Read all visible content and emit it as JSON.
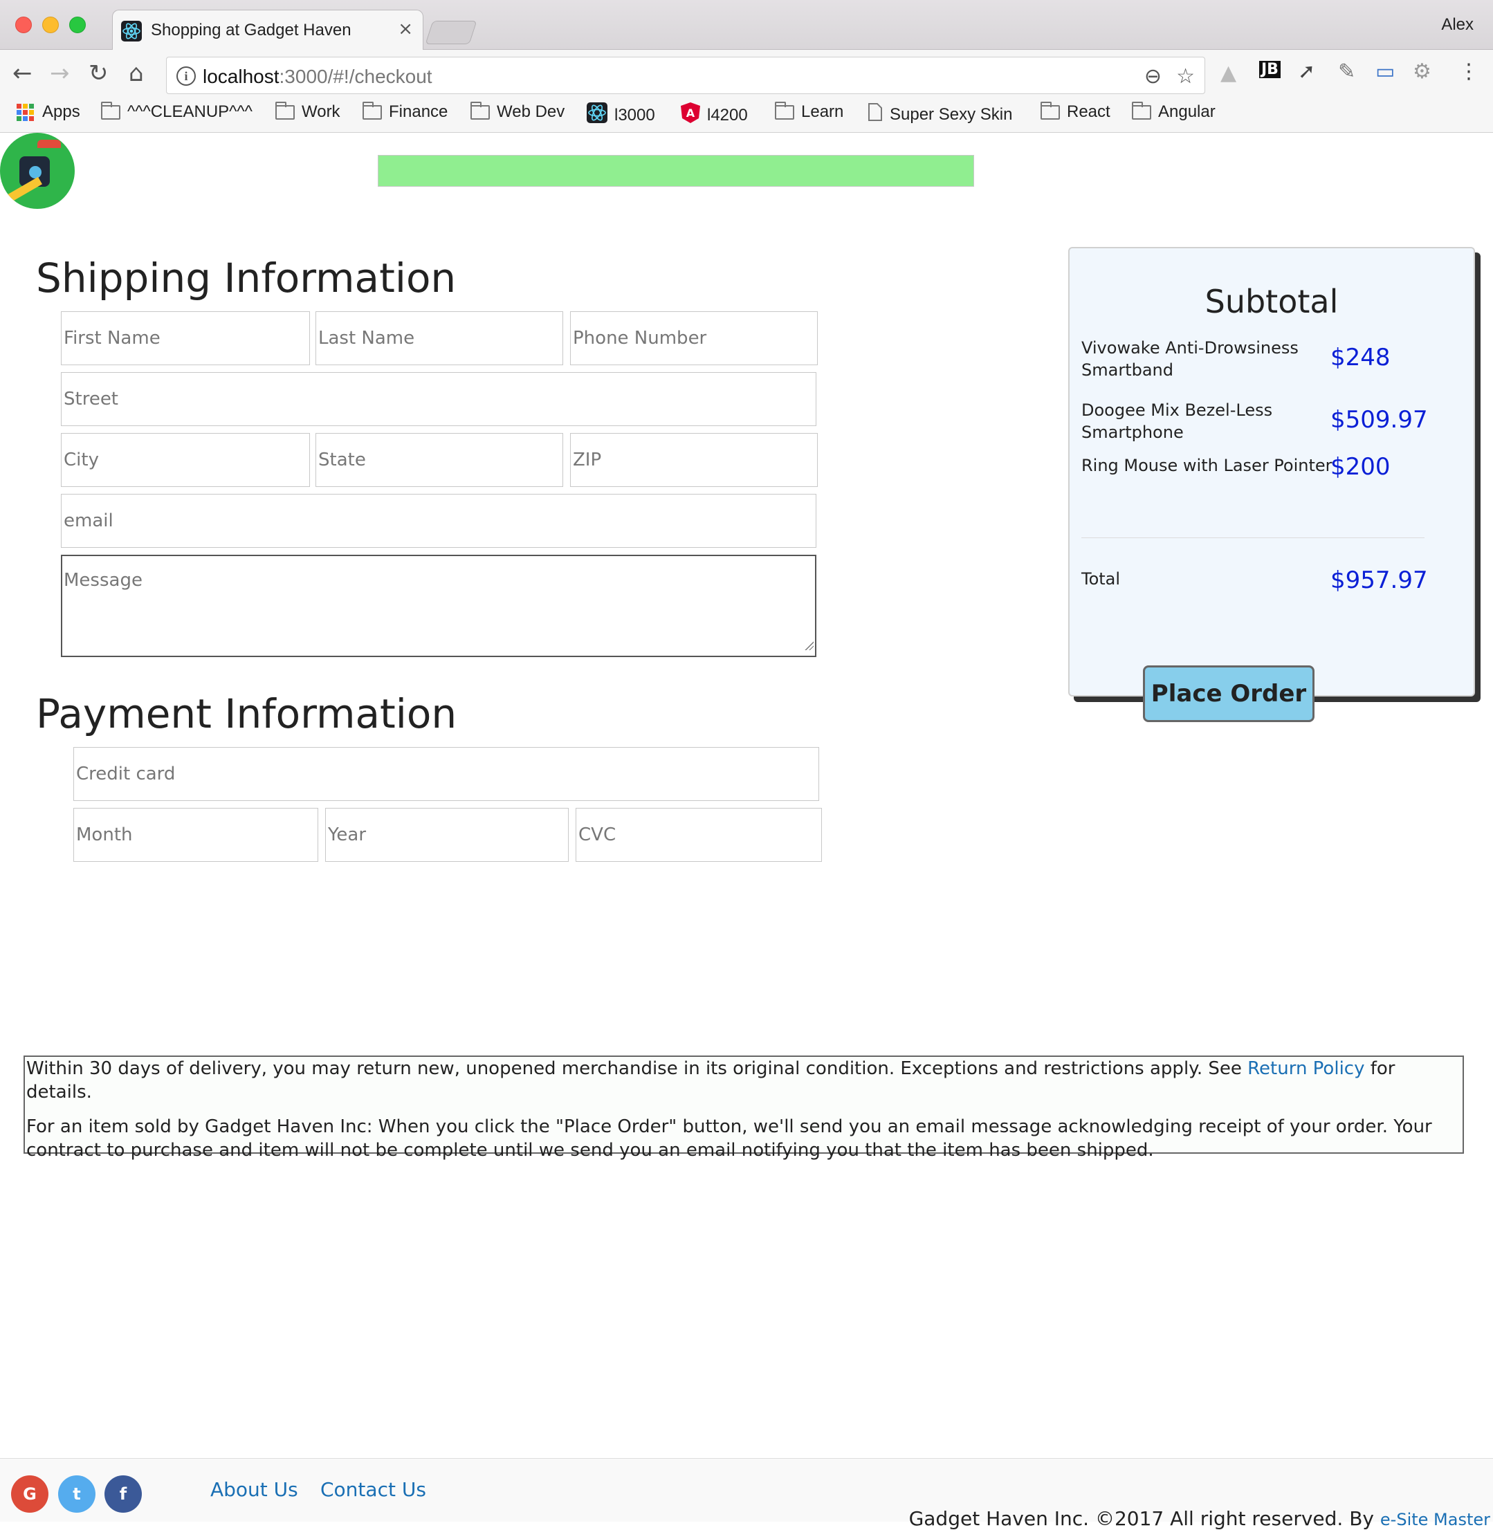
{
  "browser": {
    "tab_title": "Shopping at Gadget Haven",
    "tab_close": "×",
    "profile_name": "Alex",
    "url_host": "localhost",
    "url_rest": ":3000/#!/checkout",
    "bookmarks": [
      "Apps",
      "^^^CLEANUP^^^",
      "Work",
      "Finance",
      "Web Dev",
      "l3000",
      "l4200",
      "Learn",
      "Super Sexy Skin",
      "React",
      "Angular"
    ]
  },
  "checkout": {
    "progress_percent": 100,
    "shipping_title": "Shipping Information",
    "fields": {
      "first_name": "First Name",
      "last_name": "Last Name",
      "phone": "Phone Number",
      "street": "Street",
      "city": "City",
      "state": "State",
      "zip": "ZIP",
      "email": "email",
      "message": "Message"
    },
    "payment_title": "Payment Information",
    "payment_fields": {
      "credit_card": "Credit card",
      "month": "Month",
      "year": "Year",
      "cvc": "CVC"
    }
  },
  "summary": {
    "title": "Subtotal",
    "items": [
      {
        "name": "Vivowake Anti-Drowsiness Smartband",
        "price": "$248"
      },
      {
        "name": "Doogee Mix Bezel-Less Smartphone",
        "price": "$509.97"
      },
      {
        "name": "Ring Mouse with Laser Pointer",
        "price": "$200"
      }
    ],
    "total_label": "Total",
    "total_value": "$957.97",
    "place_order": "Place Order"
  },
  "notice": {
    "line1_before": "Within 30 days of delivery, you may return new, unopened merchandise in its original condition. Exceptions and restrictions apply. See ",
    "line1_link": "Return Policy",
    "line1_after": " for details.",
    "line2": "For an item sold by Gadget Haven Inc: When you click the \"Place Order\" button, we'll send you an email message acknowledging receipt of your order. Your contract to purchase and item will not be complete until we send you an email notifying you that the item has been shipped."
  },
  "footer": {
    "social": [
      "G",
      "t",
      "f"
    ],
    "about": "About Us",
    "contact": "Contact Us",
    "copyright": "Gadget Haven Inc. ©2017 All right reserved. By ",
    "credit_link": "e-Site Master"
  },
  "colors": {
    "progress": "#90ee90",
    "button": "#87ceeb",
    "price": "#0a1fd6",
    "link": "#1a6fb4"
  }
}
